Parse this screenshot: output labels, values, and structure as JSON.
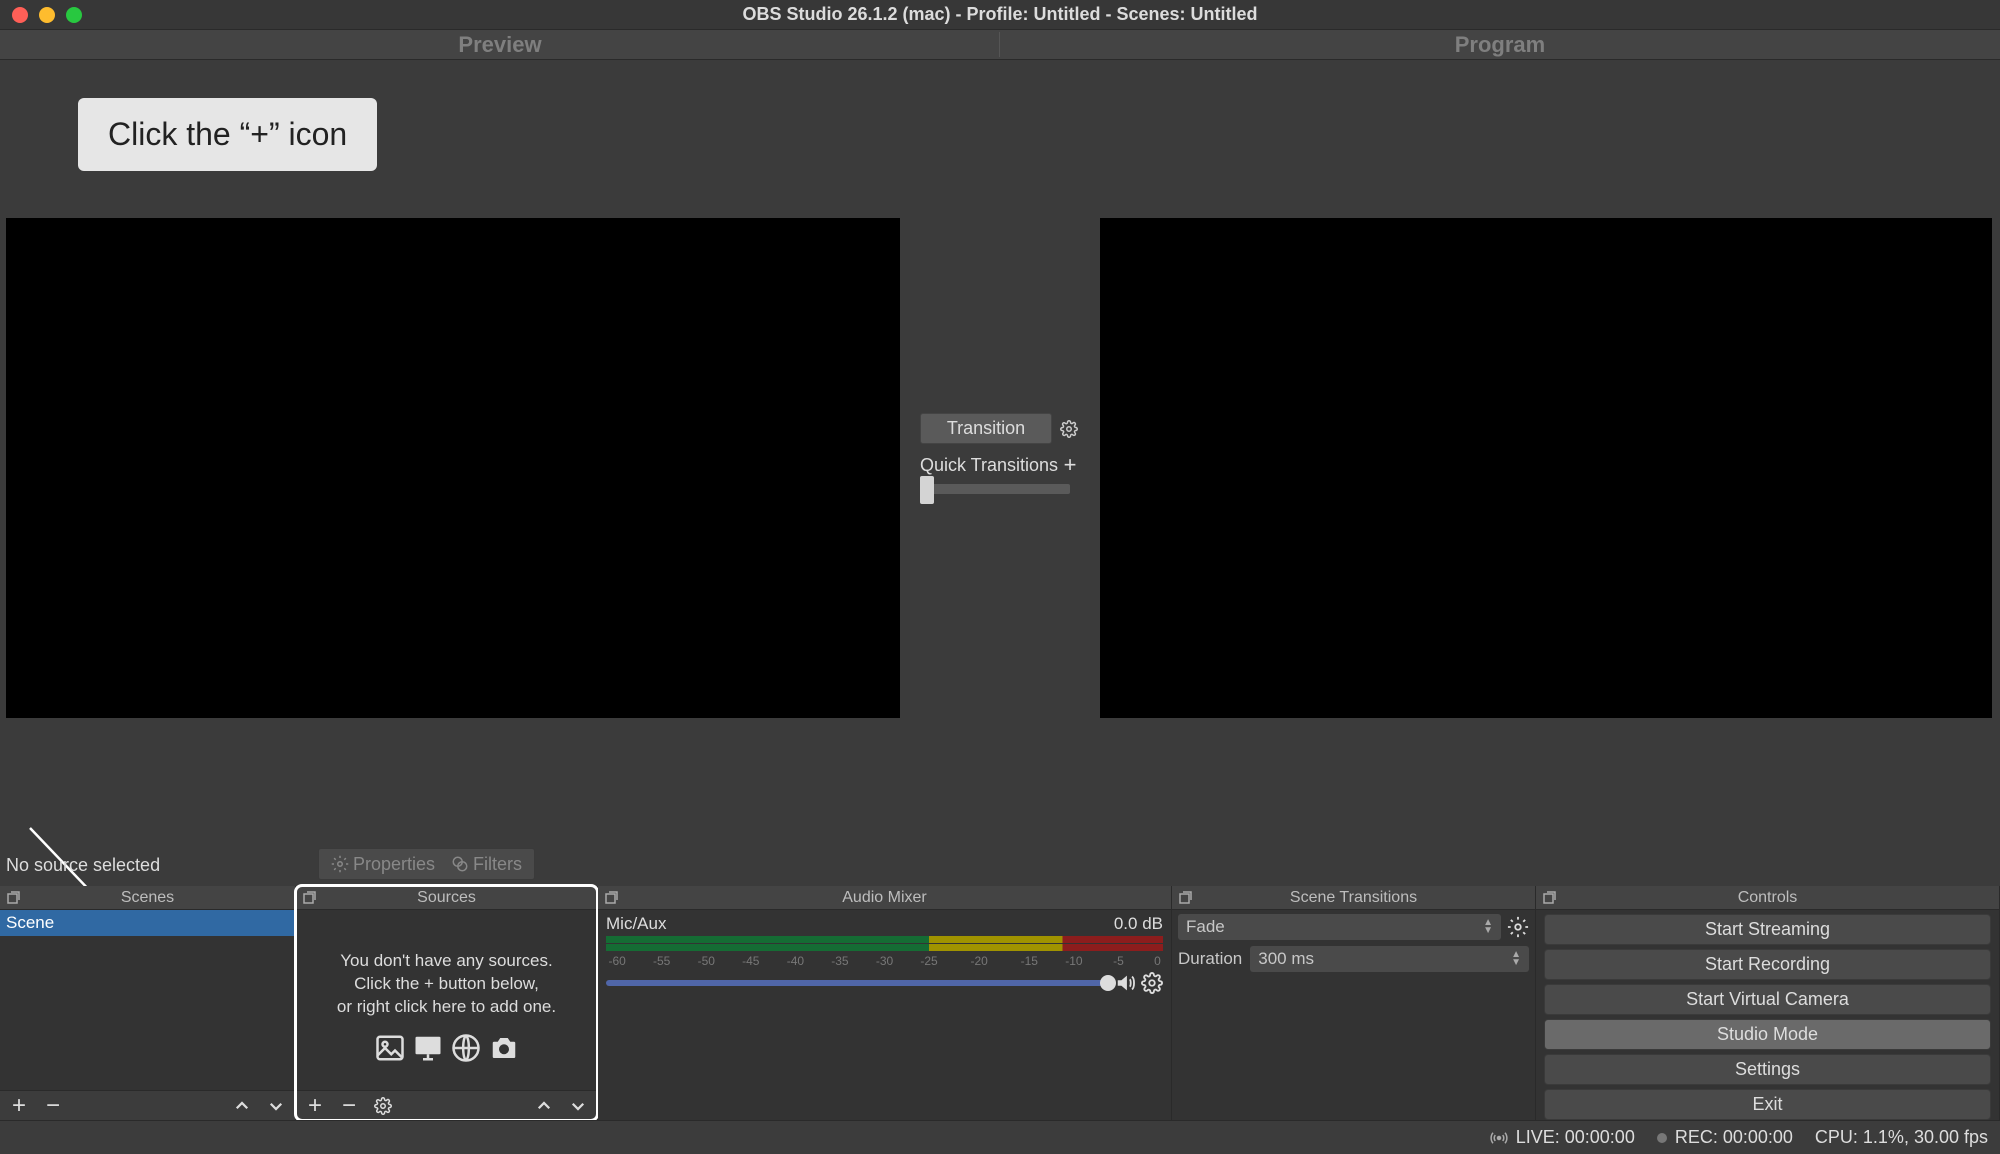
{
  "titlebar": {
    "title": "OBS Studio 26.1.2 (mac) - Profile: Untitled - Scenes: Untitled"
  },
  "panels": {
    "preview_label": "Preview",
    "program_label": "Program"
  },
  "instruction": "Click the “+” icon",
  "transition": {
    "button": "Transition",
    "quick_label": "Quick Transitions"
  },
  "toolbar": {
    "no_source": "No source selected",
    "properties": "Properties",
    "filters": "Filters"
  },
  "scenes": {
    "title": "Scenes",
    "items": [
      "Scene"
    ]
  },
  "sources": {
    "title": "Sources",
    "empty_line1": "You don't have any sources.",
    "empty_line2": "Click the + button below,",
    "empty_line3": "or right click here to add one."
  },
  "mixer": {
    "title": "Audio Mixer",
    "track_name": "Mic/Aux",
    "level": "0.0 dB",
    "ticks": [
      "-60",
      "-55",
      "-50",
      "-45",
      "-40",
      "-35",
      "-30",
      "-25",
      "-20",
      "-15",
      "-10",
      "-5",
      "0"
    ]
  },
  "scene_transitions": {
    "title": "Scene Transitions",
    "selected": "Fade",
    "duration_label": "Duration",
    "duration_value": "300 ms"
  },
  "controls": {
    "title": "Controls",
    "start_streaming": "Start Streaming",
    "start_recording": "Start Recording",
    "start_virtual_cam": "Start Virtual Camera",
    "studio_mode": "Studio Mode",
    "settings": "Settings",
    "exit": "Exit"
  },
  "statusbar": {
    "live": "LIVE: 00:00:00",
    "rec": "REC: 00:00:00",
    "cpu": "CPU: 1.1%, 30.00 fps"
  }
}
